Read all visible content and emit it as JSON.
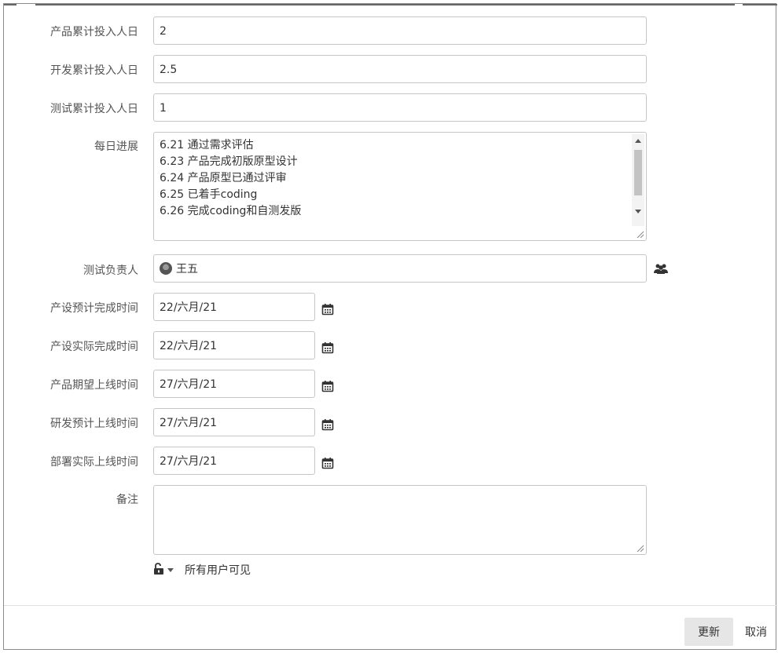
{
  "form": {
    "product_days": {
      "label": "产品累计投入人日",
      "value": "2"
    },
    "dev_days": {
      "label": "开发累计投入人日",
      "value": "2.5"
    },
    "test_days": {
      "label": "测试累计投入人日",
      "value": "1"
    },
    "daily_progress": {
      "label": "每日进展",
      "lines": [
        "6.21  通过需求评估",
        "6.23  产品完成初版原型设计",
        "6.24  产品原型已通过评审",
        "6.25 已着手coding",
        "6.26 完成coding和自测发版"
      ]
    },
    "test_owner": {
      "label": "测试负责人",
      "value": "王五"
    },
    "design_planned": {
      "label": "产设预计完成时间",
      "value": "22/六月/21"
    },
    "design_actual": {
      "label": "产设实际完成时间",
      "value": "22/六月/21"
    },
    "product_launch": {
      "label": "产品期望上线时间",
      "value": "27/六月/21"
    },
    "dev_launch": {
      "label": "研发预计上线时间",
      "value": "27/六月/21"
    },
    "deploy_actual": {
      "label": "部署实际上线时间",
      "value": "27/六月/21"
    },
    "remarks": {
      "label": "备注",
      "value": ""
    },
    "visibility": {
      "label": "所有用户可见"
    }
  },
  "footer": {
    "update_label": "更新",
    "cancel_label": "取消"
  },
  "icons": {
    "calendar": "calendar-icon",
    "group": "user-group-icon",
    "lock": "unlock-icon",
    "avatar": "avatar"
  }
}
